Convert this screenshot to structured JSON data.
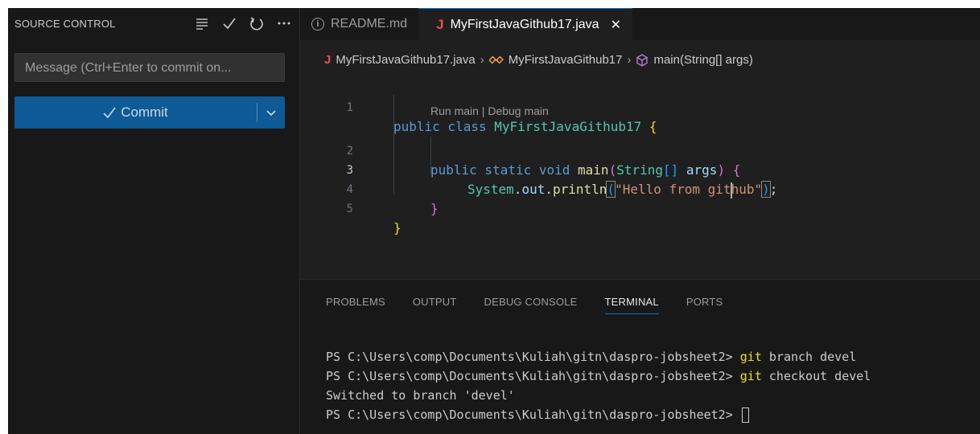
{
  "sidebar": {
    "title": "SOURCE CONTROL",
    "actions": [
      "list-icon",
      "check-icon",
      "refresh-icon",
      "more-icon"
    ],
    "message_placeholder": "Message (Ctrl+Enter to commit on...",
    "commit_label": "Commit"
  },
  "tabs": [
    {
      "label": "README.md",
      "icon": "info-icon",
      "active": false
    },
    {
      "label": "MyFirstJavaGithub17.java",
      "icon": "java-icon",
      "active": true
    }
  ],
  "breadcrumb": {
    "file": "MyFirstJavaGithub17.java",
    "class": "MyFirstJavaGithub17",
    "method": "main(String[] args)"
  },
  "code": {
    "line_numbers": [
      "1",
      "2",
      "3",
      "4",
      "5"
    ],
    "codelens": "Run main | Debug main",
    "class_name": "MyFirstJavaGithub17",
    "string_part1": "\"Hello from git",
    "string_part2": "hub\""
  },
  "panel": {
    "tabs": [
      "PROBLEMS",
      "OUTPUT",
      "DEBUG CONSOLE",
      "TERMINAL",
      "PORTS"
    ],
    "active_tab": "TERMINAL",
    "terminal": {
      "prompt": "PS C:\\Users\\comp\\Documents\\Kuliah\\gitn\\daspro-jobsheet2> ",
      "cmd1": "git",
      "args1": " branch devel",
      "cmd2": "git",
      "args2": " checkout devel",
      "output": "Switched to branch 'devel'"
    }
  },
  "colors": {
    "accent": "#0078d4",
    "commit_button": "#0e5a96",
    "java_icon": "#f14c4c"
  }
}
